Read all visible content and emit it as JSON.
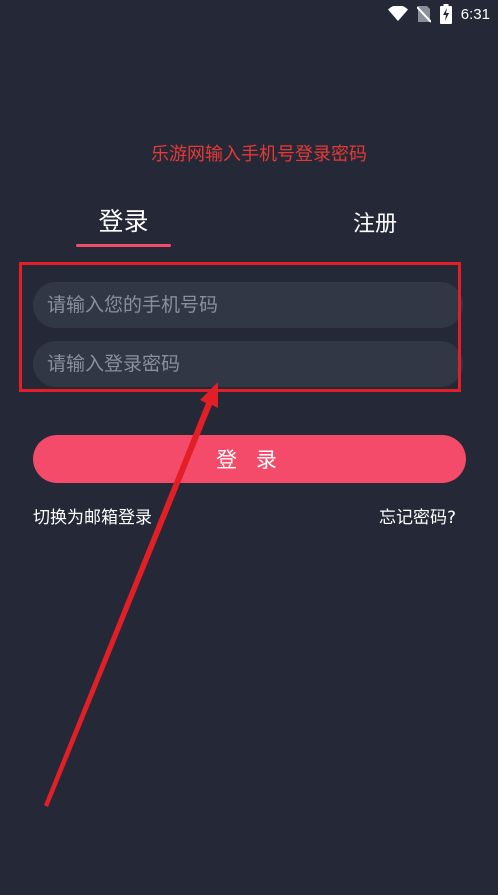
{
  "status_bar": {
    "time": "6:31",
    "icons": [
      "wifi-icon",
      "no-sim-icon",
      "battery-charging-icon"
    ]
  },
  "annotation": {
    "title": "乐游网输入手机号登录密码",
    "color": "#e53935"
  },
  "tabs": {
    "login_label": "登录",
    "register_label": "注册",
    "active": "login"
  },
  "form": {
    "phone_placeholder": "请输入您的手机号码",
    "password_placeholder": "请输入登录密码",
    "submit_label": "登 录"
  },
  "links": {
    "switch_email": "切换为邮箱登录",
    "forgot_password": "忘记密码?"
  },
  "colors": {
    "background": "#252937",
    "accent": "#f34b69",
    "input_bg": "#323746",
    "annotation_red": "#e21f26"
  }
}
